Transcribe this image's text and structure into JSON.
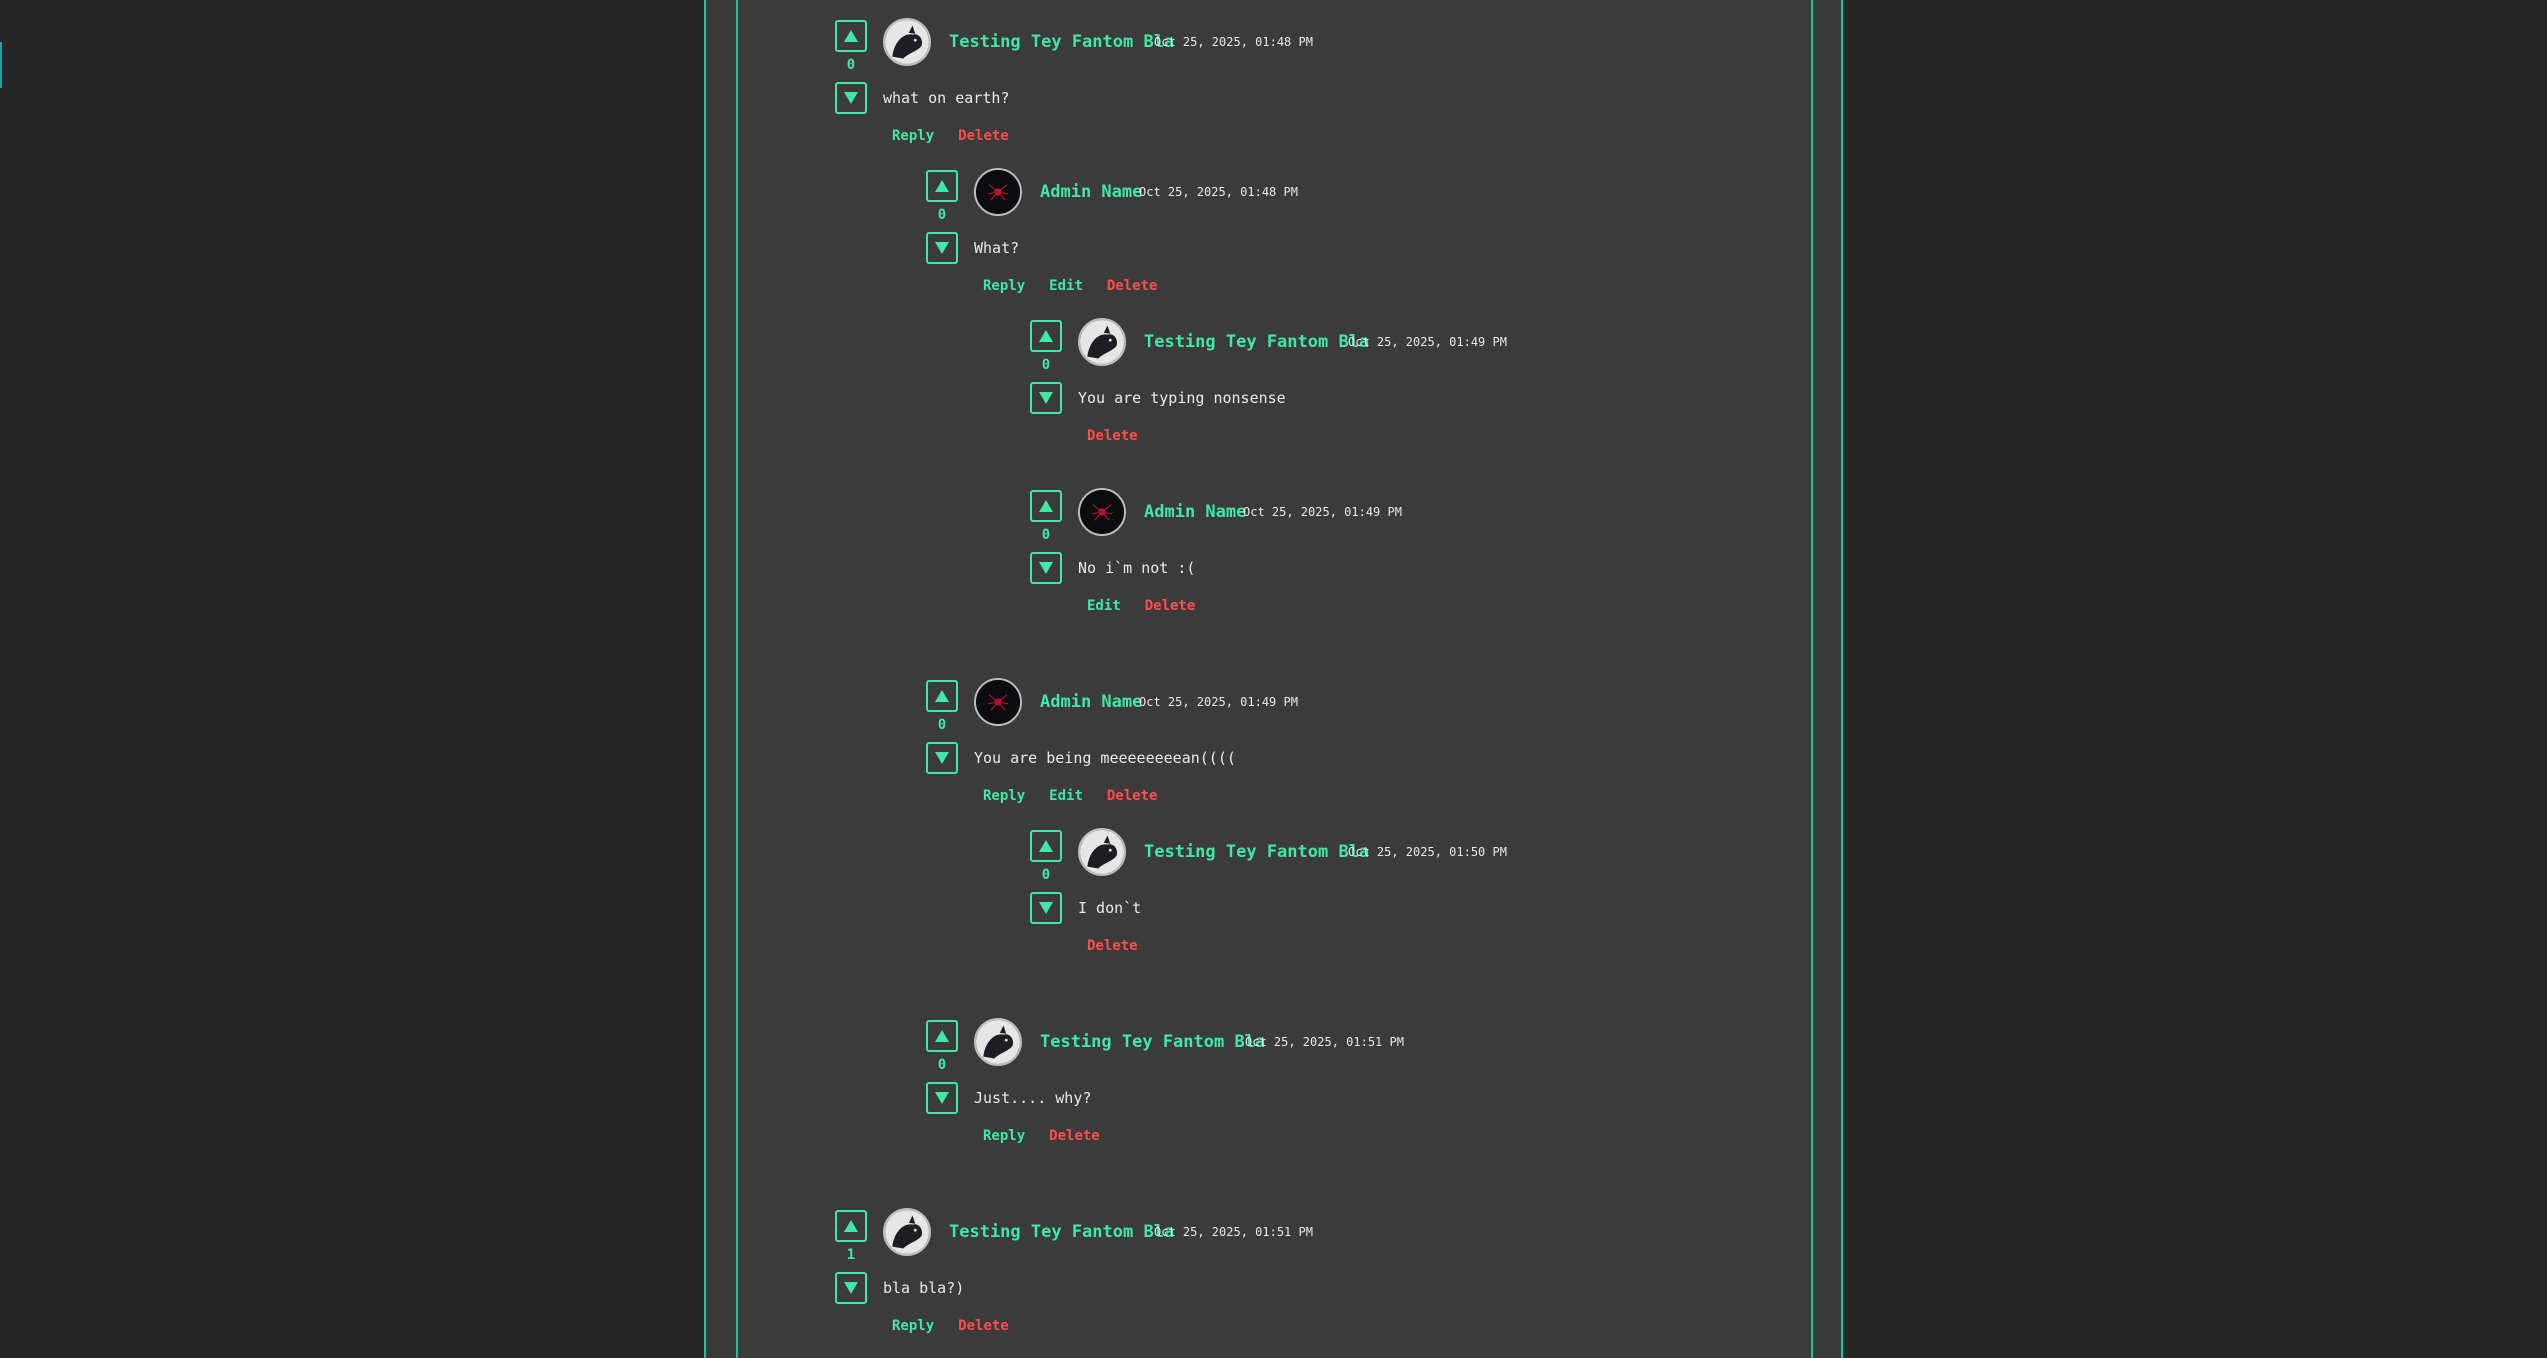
{
  "icons": {
    "upvote": "triangle-up-icon",
    "downvote": "triangle-down-icon",
    "avatar_user": "cat-avatar-icon",
    "avatar_admin": "red-spider-avatar-icon"
  },
  "colors": {
    "accent": "#3fe8a4",
    "danger": "#ff4d4d",
    "panel_border": "#16c79a",
    "background": "#262626"
  },
  "comments": [
    {
      "author": "Testing Tey Fantom Bla",
      "timestamp": "Oct 25, 2025, 01:48 PM",
      "text": "what on earth?",
      "score": "0",
      "avatar": "cat",
      "actions": {
        "reply": "Reply",
        "delete": "Delete"
      }
    },
    {
      "author": "Admin Name",
      "timestamp": "Oct 25, 2025, 01:48 PM",
      "text": "What?",
      "score": "0",
      "avatar": "admin",
      "actions": {
        "reply": "Reply",
        "edit": "Edit",
        "delete": "Delete"
      }
    },
    {
      "author": "Testing Tey Fantom Bla",
      "timestamp": "Oct 25, 2025, 01:49 PM",
      "text": "You are typing nonsense",
      "score": "0",
      "avatar": "cat",
      "actions": {
        "delete": "Delete"
      }
    },
    {
      "author": "Admin Name",
      "timestamp": "Oct 25, 2025, 01:49 PM",
      "text": "No i`m not :(",
      "score": "0",
      "avatar": "admin",
      "actions": {
        "edit": "Edit",
        "delete": "Delete"
      }
    },
    {
      "author": "Admin Name",
      "timestamp": "Oct 25, 2025, 01:49 PM",
      "text": "You are being meeeeeeeean((((",
      "score": "0",
      "avatar": "admin",
      "actions": {
        "reply": "Reply",
        "edit": "Edit",
        "delete": "Delete"
      }
    },
    {
      "author": "Testing Tey Fantom Bla",
      "timestamp": "Oct 25, 2025, 01:50 PM",
      "text": "I don`t",
      "score": "0",
      "avatar": "cat",
      "actions": {
        "delete": "Delete"
      }
    },
    {
      "author": "Testing Tey Fantom Bla",
      "timestamp": "Oct 25, 2025, 01:51 PM",
      "text": "Just.... why?",
      "score": "0",
      "avatar": "cat",
      "actions": {
        "reply": "Reply",
        "delete": "Delete"
      }
    },
    {
      "author": "Testing Tey Fantom Bla",
      "timestamp": "Oct 25, 2025, 01:51 PM",
      "text": "bla bla?)",
      "score": "1",
      "avatar": "cat",
      "actions": {
        "reply": "Reply",
        "delete": "Delete"
      }
    }
  ]
}
